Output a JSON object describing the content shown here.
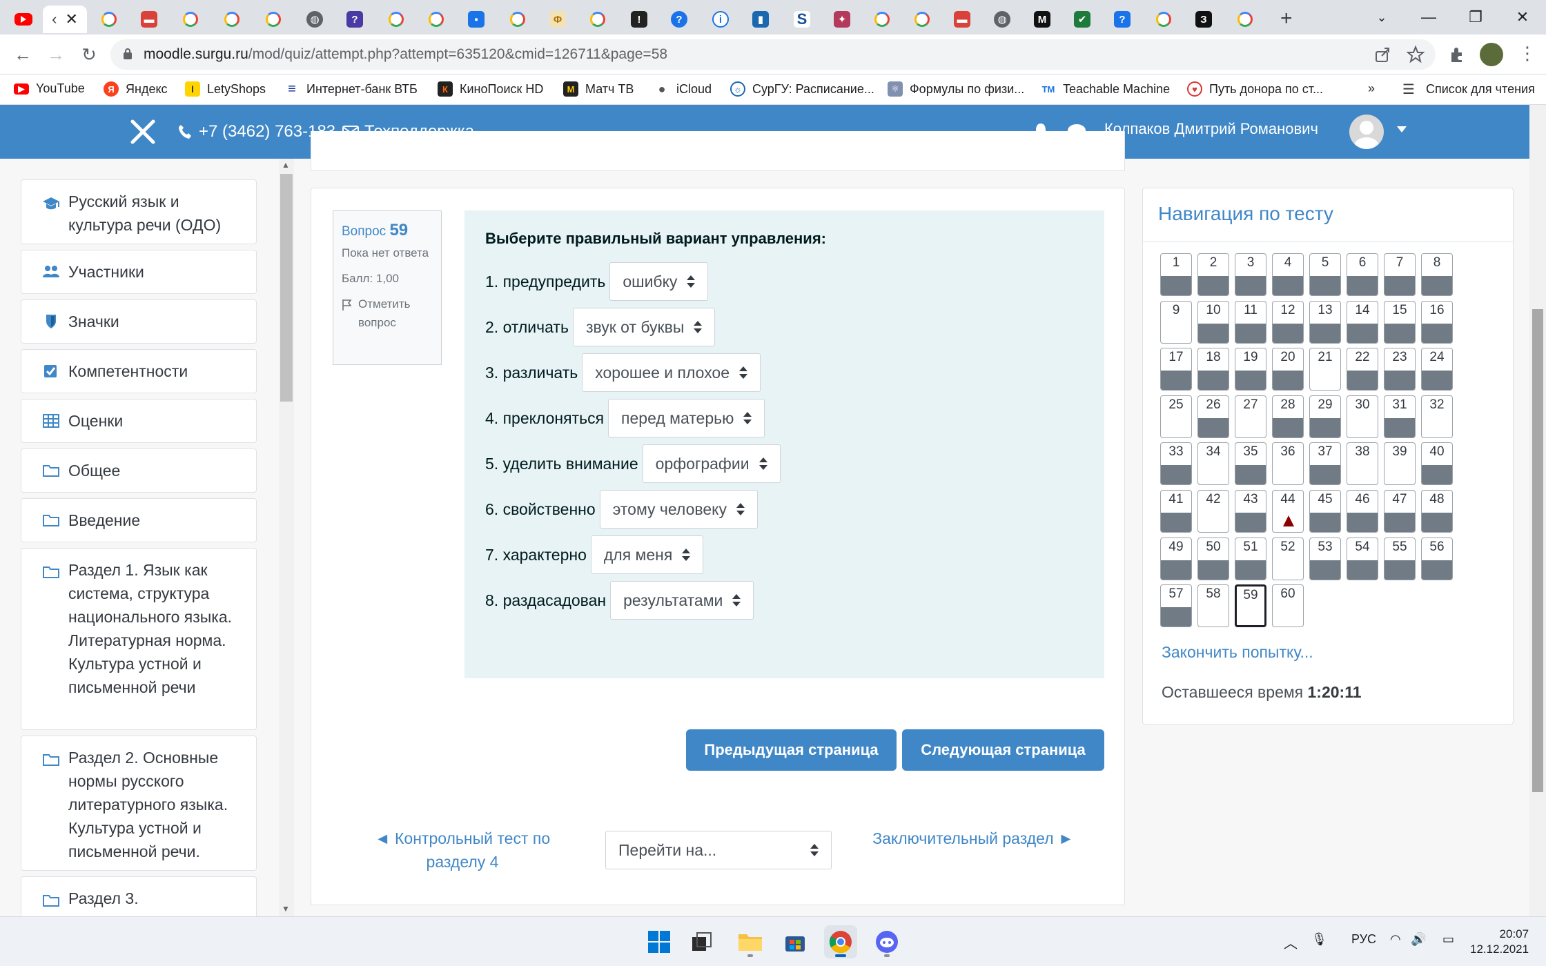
{
  "browser": {
    "active_tab_label": "‹",
    "url_host": "moodle.surgu.ru",
    "url_path": "/mod/quiz/attempt.php?attempt=635120&cmid=126711&page=58",
    "bookmarks": [
      "YouTube",
      "Яндекс",
      "LetyShops",
      "Интернет-банк ВТБ",
      "КиноПоиск HD",
      "Матч ТВ",
      "iCloud",
      "СурГУ: Расписание...",
      "Формулы по физи...",
      "Teachable Machine",
      "Путь донора по ст..."
    ],
    "bookmarks_more": "»",
    "reading_list": "Список для чтения"
  },
  "header": {
    "phone": "+7 (3462) 763-183",
    "support": "Техподдержка",
    "user_name": "Колпаков Дмитрий Романович"
  },
  "drawer": [
    "Русский язык и культура речи (ОДО)",
    "Участники",
    "Значки",
    "Компетентности",
    "Оценки",
    "Общее",
    "Введение",
    "Раздел 1. Язык как система, структура национального языка. Литературная норма. Культура устной и письменной речи",
    "Раздел 2. Основные нормы русского литературного языка. Культура устной и письменной речи.",
    "Раздел 3."
  ],
  "question": {
    "label": "Вопрос",
    "number": "59",
    "state": "Пока нет ответа",
    "grade": "Балл: 1,00",
    "flag_label": "Отметить вопрос",
    "prompt": "Выберите правильный вариант управления:",
    "items": [
      {
        "label": "1. предупредить",
        "value": "ошибку"
      },
      {
        "label": "2. отличать",
        "value": "звук от буквы"
      },
      {
        "label": "3. различать",
        "value": "хорошее и плохое"
      },
      {
        "label": "4. преклоняться",
        "value": "перед матерью"
      },
      {
        "label": "5. уделить внимание",
        "value": "орфографии"
      },
      {
        "label": "6. свойственно",
        "value": "этому человеку"
      },
      {
        "label": "7. характерно",
        "value": "для меня"
      },
      {
        "label": "8. раздасадован",
        "value": "результатами"
      }
    ]
  },
  "buttons": {
    "prev": "Предыдущая страница",
    "next": "Следующая страница"
  },
  "activity_nav": {
    "prev_link": "◄ Контрольный тест по разделу 4",
    "jump_placeholder": "Перейти на...",
    "next_link": "Заключительный раздел ►"
  },
  "quiz_nav": {
    "title": "Навигация по тесту",
    "total": 60,
    "current": 59,
    "answered": [
      1,
      2,
      3,
      4,
      5,
      6,
      7,
      8,
      10,
      11,
      12,
      13,
      14,
      15,
      16,
      17,
      18,
      19,
      20,
      22,
      23,
      24,
      26,
      28,
      29,
      31,
      33,
      35,
      37,
      40,
      41,
      43,
      45,
      46,
      47,
      48,
      49,
      50,
      51,
      53,
      54,
      55,
      56,
      57
    ],
    "flagged": [
      44
    ],
    "finish": "Закончить попытку...",
    "time_label": "Оставшееся время",
    "time_value": "1:20:11"
  },
  "taskbar": {
    "lang": "РУС",
    "time": "20:07",
    "date": "12.12.2021"
  }
}
